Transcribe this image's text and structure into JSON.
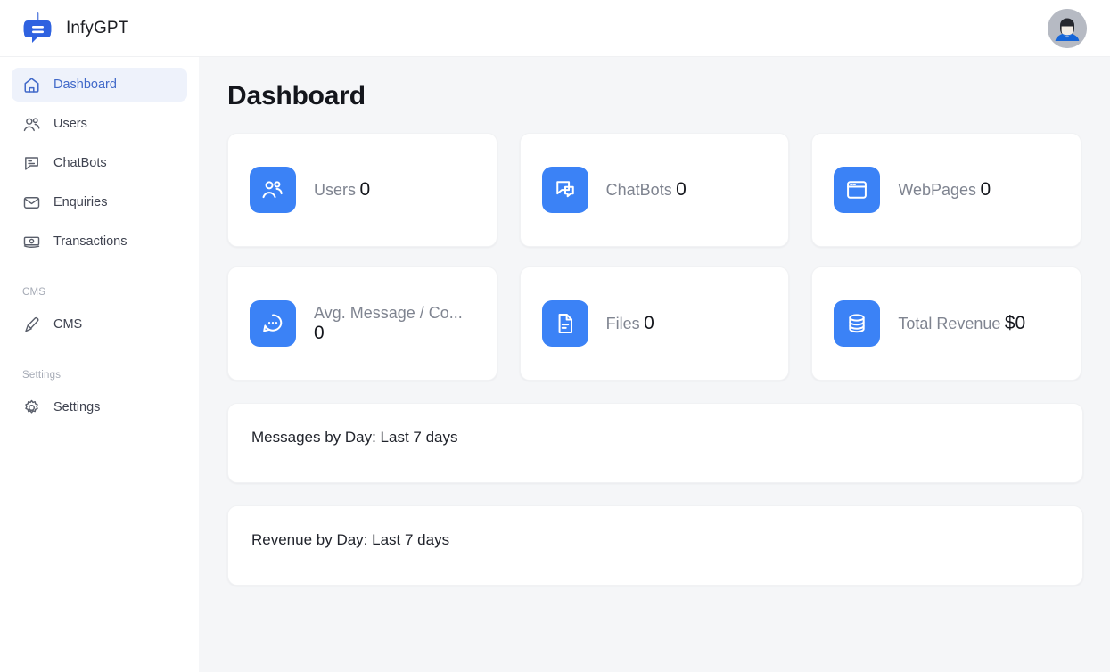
{
  "app": {
    "brand_name": "InfyGPT",
    "logo_icon": "chatbot-logo-icon",
    "avatar_icon": "user-avatar-icon"
  },
  "sidebar": {
    "items": [
      {
        "label": "Dashboard",
        "icon": "home-icon",
        "active": true
      },
      {
        "label": "Users",
        "icon": "users-icon",
        "active": false
      },
      {
        "label": "ChatBots",
        "icon": "chat-bubble-icon",
        "active": false
      },
      {
        "label": "Enquiries",
        "icon": "envelope-icon",
        "active": false
      },
      {
        "label": "Transactions",
        "icon": "banknote-icon",
        "active": false
      }
    ],
    "sections": [
      {
        "title": "CMS",
        "items": [
          {
            "label": "CMS",
            "icon": "paintbrush-icon",
            "active": false
          }
        ]
      },
      {
        "title": "Settings",
        "items": [
          {
            "label": "Settings",
            "icon": "gear-icon",
            "active": false
          }
        ]
      }
    ]
  },
  "main": {
    "page_title": "Dashboard",
    "accent_color": "#3b82f6",
    "stat_cards": [
      {
        "label": "Users",
        "value": "0",
        "icon": "users-icon"
      },
      {
        "label": "ChatBots",
        "value": "0",
        "icon": "chat-bubble-icon"
      },
      {
        "label": "WebPages",
        "value": "0",
        "icon": "browser-window-icon"
      },
      {
        "label": "Avg. Message / Co...",
        "value": "0",
        "icon": "chat-dots-icon"
      },
      {
        "label": "Files",
        "value": "0",
        "icon": "file-document-icon"
      },
      {
        "label": "Total Revenue",
        "value": "$0",
        "icon": "database-coins-icon"
      }
    ],
    "panels": [
      {
        "title": "Messages by Day: Last 7 days"
      },
      {
        "title": "Revenue by Day: Last 7 days"
      }
    ]
  }
}
